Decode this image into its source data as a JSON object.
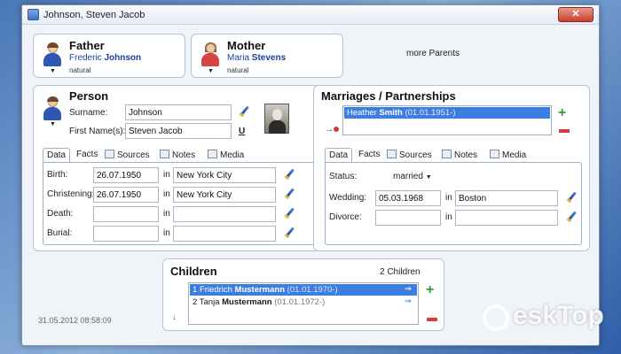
{
  "window": {
    "title": "Johnson, Steven Jacob",
    "close_glyph": "✕"
  },
  "father": {
    "title": "Father",
    "first": "Frederic",
    "last": "Johnson",
    "relation": "natural"
  },
  "mother": {
    "title": "Mother",
    "first": "Maria",
    "last": "Stevens",
    "relation": "natural"
  },
  "more_parents": "more Parents",
  "person": {
    "title": "Person",
    "surname_label": "Surname:",
    "surname": "Johnson",
    "firstnames_label": "First Name(s):",
    "firstnames": "Steven Jacob",
    "underline_glyph": "U",
    "tabs": [
      "Data",
      "Facts",
      "Sources",
      "Notes",
      "Media"
    ],
    "in_label": "in",
    "events": [
      {
        "label": "Birth:",
        "date": "26.07.1950",
        "place": "New York City"
      },
      {
        "label": "Christening:",
        "date": "26.07.1950",
        "place": "New York City"
      },
      {
        "label": "Death:",
        "date": "",
        "place": ""
      },
      {
        "label": "Burial:",
        "date": "",
        "place": ""
      }
    ]
  },
  "marriages": {
    "title": "Marriages / Partnerships",
    "partners": [
      {
        "first": "Heather",
        "last": "Smith",
        "date": "(01.01.1951-)"
      }
    ],
    "tabs": [
      "Data",
      "Facts",
      "Sources",
      "Notes",
      "Media"
    ],
    "status_label": "Status:",
    "status_value": "married",
    "wedding_label": "Wedding:",
    "wedding_date": "05.03.1968",
    "wedding_place": "Boston",
    "divorce_label": "Divorce:",
    "in_label": "in"
  },
  "children": {
    "title": "Children",
    "count": "2 Children",
    "items": [
      {
        "num": "1",
        "first": "Friedrich",
        "last": "Mustermann",
        "date": "(01.01.1970-)",
        "arrow": "⇒"
      },
      {
        "num": "2",
        "first": "Tanja",
        "last": "Mustermann",
        "date": "(01.01.1972-)",
        "arrow": "⇒"
      }
    ]
  },
  "timestamp": "31.05.2012 08:58:09",
  "watermark": "eskTop",
  "colors": {
    "accent": "#3b7de0",
    "link": "#1b3f9e",
    "add": "#2aa02a",
    "remove": "#d93838"
  }
}
